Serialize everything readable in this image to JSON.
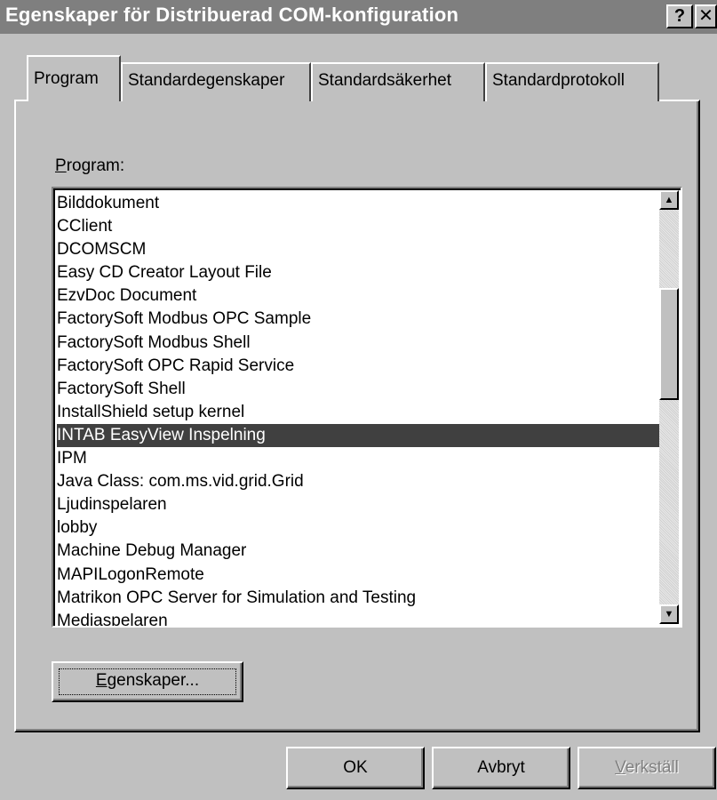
{
  "window": {
    "title": "Egenskaper för Distribuerad COM-konfiguration",
    "help_glyph": "?",
    "close_glyph": "✕"
  },
  "tabs": [
    {
      "label": "Program",
      "active": true
    },
    {
      "label": "Standardegenskaper",
      "active": false
    },
    {
      "label": "Standardsäkerhet",
      "active": false
    },
    {
      "label": "Standardprotokoll",
      "active": false
    }
  ],
  "program_section": {
    "label_first": "P",
    "label_rest": "rogram:"
  },
  "program_list": {
    "items": [
      "Bilddokument",
      "CClient",
      "DCOMSCM",
      "Easy CD Creator Layout File",
      "EzvDoc Document",
      "FactorySoft Modbus OPC Sample",
      "FactorySoft Modbus Shell",
      "FactorySoft OPC Rapid Service",
      "FactorySoft Shell",
      "InstallShield setup kernel",
      "INTAB EasyView Inspelning",
      "IPM",
      "Java Class: com.ms.vid.grid.Grid",
      "Ljudinspelaren",
      "lobby",
      "Machine Debug Manager",
      "MAPILogonRemote",
      "Matrikon OPC Server for Simulation and Testing",
      "Mediaspelaren"
    ],
    "selected": "INTAB EasyView Inspelning",
    "scroll_up_glyph": "▲",
    "scroll_down_glyph": "▼"
  },
  "buttons": {
    "properties_first": "E",
    "properties_rest": "genskaper...",
    "ok": "OK",
    "cancel": "Avbryt",
    "apply_first": "V",
    "apply_rest": "erkställ"
  },
  "colors": {
    "face": "#c0c0c0",
    "titlebar": "#7f7f7f",
    "selection": "#404040"
  }
}
